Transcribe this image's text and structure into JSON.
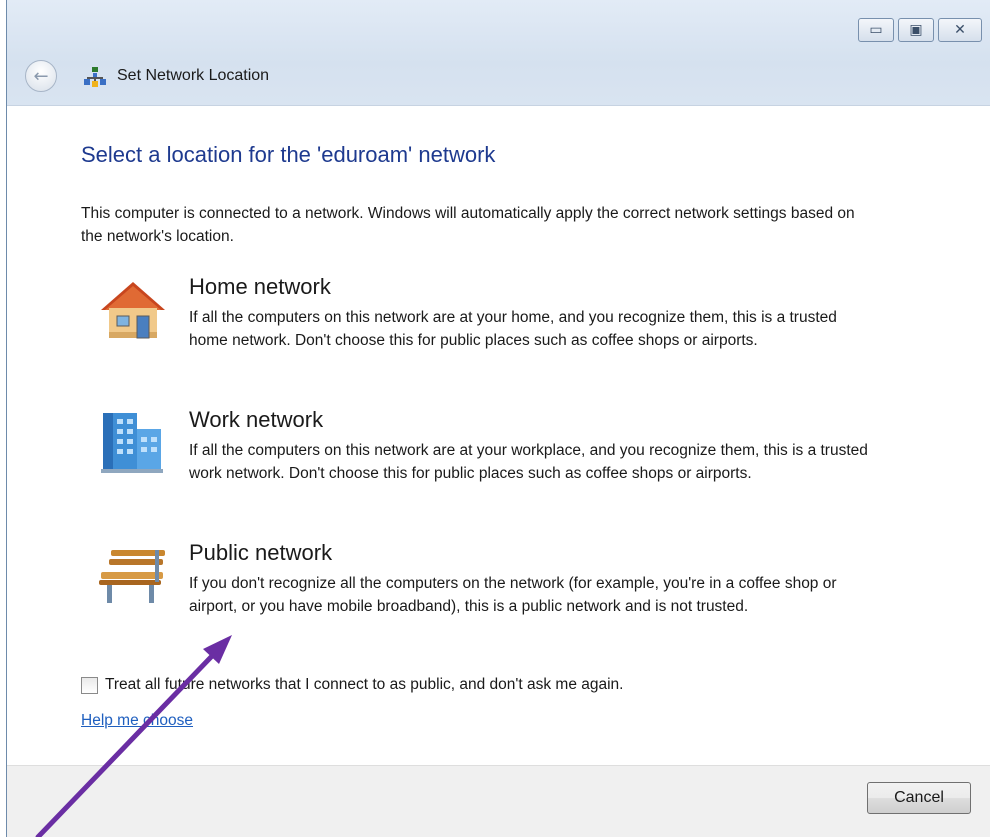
{
  "window": {
    "title": "Set Network Location",
    "caption_buttons": [
      "minimize",
      "maximize",
      "close"
    ]
  },
  "heading": "Select a location for the 'eduroam' network",
  "intro": "This computer is connected to a network. Windows will automatically apply the correct network settings based on the network's location.",
  "options": [
    {
      "title": "Home network",
      "description": "If all the computers on this network are at your home, and you recognize them, this is a trusted home network.  Don't choose this for public places such as coffee shops or airports.",
      "icon": "house-icon"
    },
    {
      "title": "Work network",
      "description": "If all the computers on this network are at your workplace, and you recognize them, this is a trusted work network.  Don't choose this for public places such as coffee shops or airports.",
      "icon": "office-building-icon"
    },
    {
      "title": "Public network",
      "description": "If you don't recognize all the computers on the network (for example, you're in a coffee shop or airport, or you have mobile broadband), this is a public network and is not trusted.",
      "icon": "park-bench-icon"
    }
  ],
  "checkbox": {
    "label": "Treat all future networks that I connect to as public, and don't ask me again.",
    "checked": false
  },
  "help_link": "Help me choose",
  "footer": {
    "cancel_label": "Cancel"
  },
  "colors": {
    "heading": "#1e3a8f",
    "link": "#1f5fbf",
    "annotation_arrow": "#6a2ea3"
  }
}
